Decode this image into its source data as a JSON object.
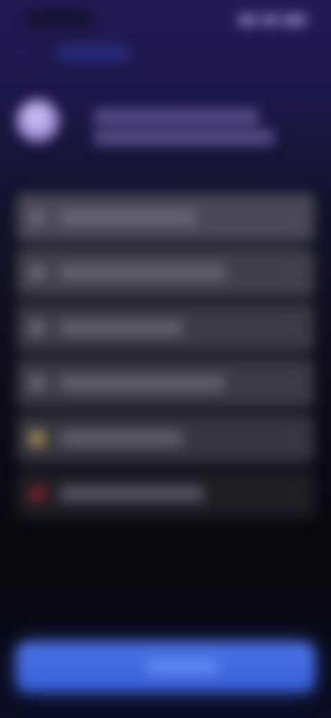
{
  "status_bar": {
    "time": "",
    "icons": [
      "signal-icon",
      "wifi-icon",
      "battery-icon"
    ]
  },
  "nav": {
    "back_label": ""
  },
  "header": {
    "title_line1": "",
    "title_line2": ""
  },
  "menu": {
    "items": [
      {
        "label": "",
        "icon": "list-icon"
      },
      {
        "label": "",
        "icon": "list-icon"
      },
      {
        "label": "",
        "icon": "list-icon"
      },
      {
        "label": "",
        "icon": "list-icon"
      },
      {
        "label": "",
        "icon": "star-icon"
      },
      {
        "label": "",
        "icon": "alert-icon"
      }
    ]
  },
  "primary_action": {
    "label": ""
  },
  "colors": {
    "accent": "#3a5fd6",
    "background_top": "#231a55",
    "background_bottom": "#07070d",
    "danger": "#7c2228",
    "warning": "#a8885a"
  }
}
